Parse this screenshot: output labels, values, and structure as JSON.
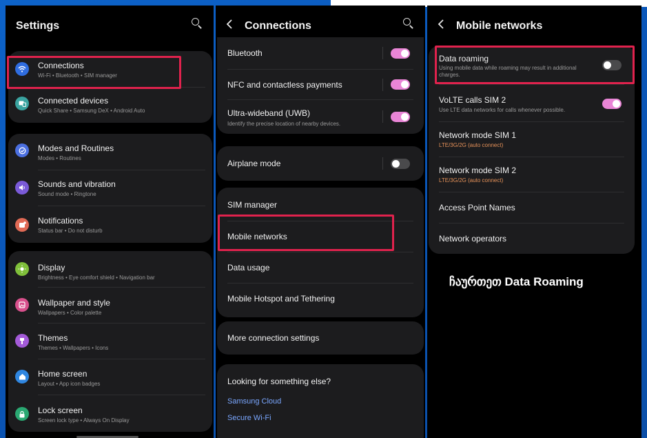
{
  "settings": {
    "title": "Settings",
    "items": [
      {
        "label": "Connections",
        "sub": "Wi-Fi  •  Bluetooth  •  SIM manager",
        "icon": "wifi-icon",
        "color": "#2f6de0"
      },
      {
        "label": "Connected devices",
        "sub": "Quick Share  •  Samsung DeX  •  Android Auto",
        "icon": "devices-icon",
        "color": "#3aa3a0"
      },
      {
        "label": "Modes and Routines",
        "sub": "Modes  •  Routines",
        "icon": "modes-icon",
        "color": "#4b6fe0"
      },
      {
        "label": "Sounds and vibration",
        "sub": "Sound mode  •  Ringtone",
        "icon": "speaker-icon",
        "color": "#7a5ad8"
      },
      {
        "label": "Notifications",
        "sub": "Status bar  •  Do not disturb",
        "icon": "notification-icon",
        "color": "#e06a55"
      },
      {
        "label": "Display",
        "sub": "Brightness  •  Eye comfort shield  •  Navigation bar",
        "icon": "sun-icon",
        "color": "#7fbf3a"
      },
      {
        "label": "Wallpaper and style",
        "sub": "Wallpapers  •  Color palette",
        "icon": "wallpaper-icon",
        "color": "#d8508c"
      },
      {
        "label": "Themes",
        "sub": "Themes  •  Wallpapers  •  Icons",
        "icon": "themes-icon",
        "color": "#a35ad8"
      },
      {
        "label": "Home screen",
        "sub": "Layout  •  App icon badges",
        "icon": "home-icon",
        "color": "#2f86e0"
      },
      {
        "label": "Lock screen",
        "sub": "Screen lock type  •  Always On Display",
        "icon": "lock-icon",
        "color": "#2aa872"
      }
    ]
  },
  "connections": {
    "title": "Connections",
    "items": [
      {
        "label": "Bluetooth",
        "toggle": "on"
      },
      {
        "label": "NFC and contactless payments",
        "toggle": "on"
      },
      {
        "label": "Ultra-wideband (UWB)",
        "sub": "Identify the precise location of nearby devices.",
        "toggle": "on"
      },
      {
        "label": "Airplane mode",
        "toggle": "off"
      },
      {
        "label": "SIM manager"
      },
      {
        "label": "Mobile networks"
      },
      {
        "label": "Data usage"
      },
      {
        "label": "Mobile Hotspot and Tethering"
      },
      {
        "label": "More connection settings"
      }
    ],
    "looking": {
      "title": "Looking for something else?",
      "links": [
        "Samsung Cloud",
        "Secure Wi-Fi"
      ]
    }
  },
  "mobile_networks": {
    "title": "Mobile networks",
    "items": [
      {
        "label": "Data roaming",
        "sub": "Using mobile data while roaming may result in additional charges.",
        "toggle": "off"
      },
      {
        "label": "VoLTE calls SIM 2",
        "sub": "Use LTE data networks for calls whenever possible.",
        "toggle": "on"
      },
      {
        "label": "Network mode SIM 1",
        "sub": "LTE/3G/2G (auto connect)"
      },
      {
        "label": "Network mode SIM 2",
        "sub": "LTE/3G/2G (auto connect)"
      },
      {
        "label": "Access Point Names"
      },
      {
        "label": "Network operators"
      }
    ],
    "caption": "ჩაურთეთ Data Roaming"
  },
  "colors": {
    "accent_toggle": "#e985d6",
    "highlight": "#e0224d",
    "background_blue": "#0d63c9"
  }
}
